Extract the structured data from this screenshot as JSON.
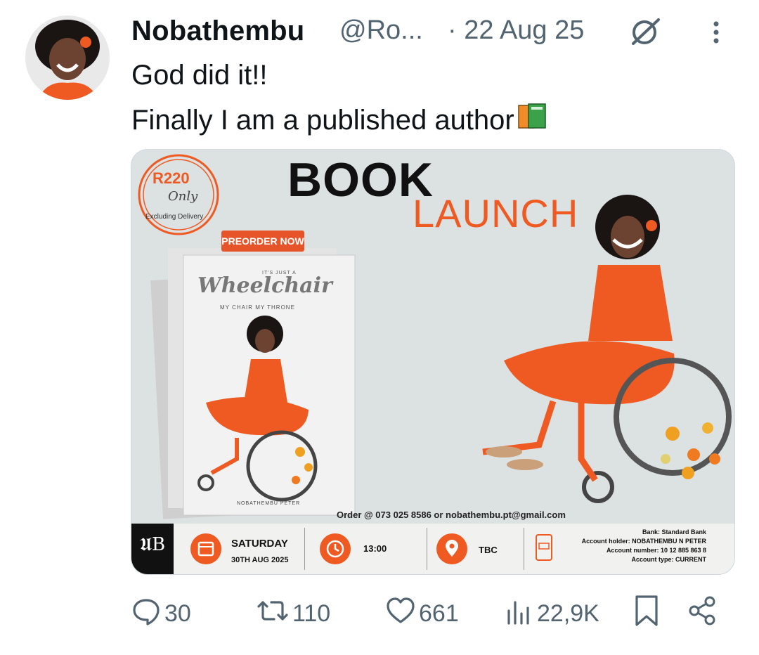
{
  "tweet": {
    "display_name": "Nobathembu",
    "handle": "@Ro...",
    "date": "· 22 Aug 25",
    "text_line1": "God did it!!",
    "text_line2": "Finally I am a published author",
    "books_icon": "books-emoji"
  },
  "poster": {
    "title": "BOOK",
    "subtitle": "LAUNCH",
    "price": "R220",
    "price_note": "Only",
    "excluding": "Excluding Delivery",
    "preorder": "PREORDER NOW",
    "book_small_top": "IT'S JUST A",
    "book_title": "Wheelchair",
    "book_subtitle": "MY CHAIR MY THRONE",
    "book_author": "NOBATHEMBU PETER",
    "order": "Order @ 073 025 8586 or nobathembu.pt@gmail.com",
    "footer": {
      "day": "SATURDAY",
      "date": "30TH AUG 2025",
      "time": "13:00",
      "venue": "TBC",
      "bank": "Bank: Standard Bank",
      "holder": "Account holder: NOBATHEMBU N PETER",
      "number": "Account number: 10 12 885 863 8",
      "type": "Account type: CURRENT"
    },
    "colors": {
      "accent": "#ef5a23",
      "background": "#dce1e2"
    }
  },
  "actions": {
    "replies": "30",
    "reposts": "110",
    "likes": "661",
    "views": "22,9K"
  }
}
